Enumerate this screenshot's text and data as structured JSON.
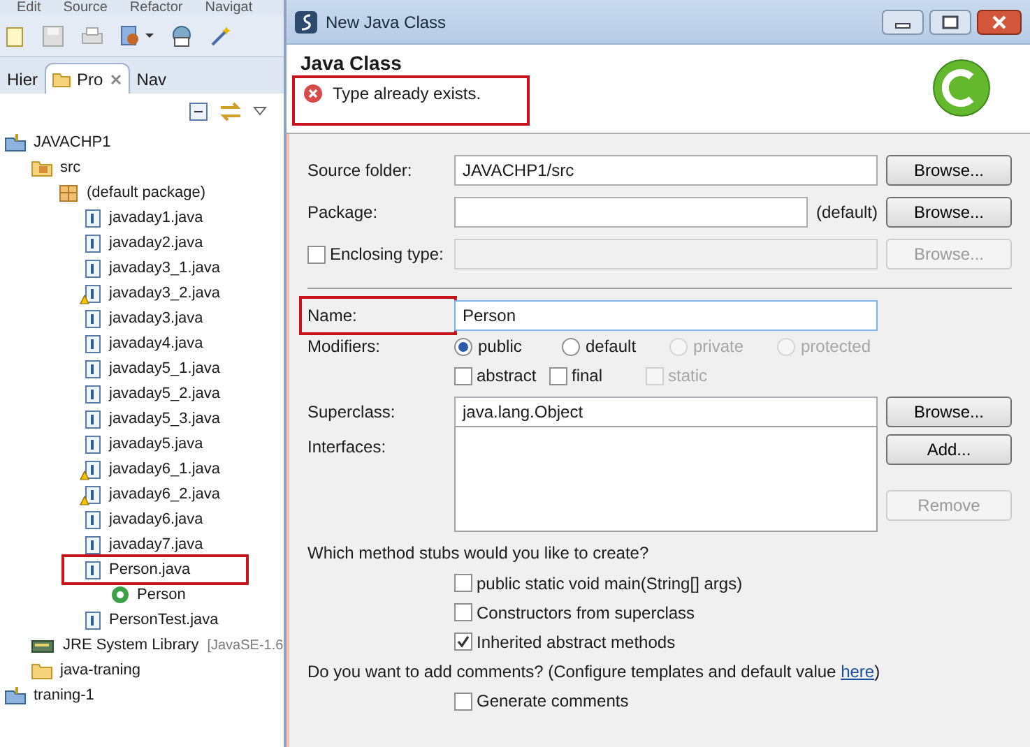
{
  "menu": [
    "Edit",
    "Source",
    "Refactor",
    "Navigat"
  ],
  "view_tabs": [
    {
      "label": "Hier",
      "selected": false,
      "closable": false
    },
    {
      "label": "Pro",
      "selected": true,
      "closable": true
    },
    {
      "label": "Nav",
      "selected": false,
      "closable": false
    }
  ],
  "tree": [
    {
      "label": "JAVACHP1",
      "kind": "project",
      "children": [
        {
          "label": "src",
          "kind": "source-folder",
          "children": [
            {
              "label": "(default package)",
              "kind": "package",
              "children": [
                {
                  "label": "javaday1.java",
                  "kind": "file",
                  "warning": false,
                  "highlighted": false
                },
                {
                  "label": "javaday2.java",
                  "kind": "file",
                  "warning": false,
                  "highlighted": false
                },
                {
                  "label": "javaday3_1.java",
                  "kind": "file",
                  "warning": false,
                  "highlighted": false
                },
                {
                  "label": "javaday3_2.java",
                  "kind": "file",
                  "warning": true,
                  "highlighted": false
                },
                {
                  "label": "javaday3.java",
                  "kind": "file",
                  "warning": false,
                  "highlighted": false
                },
                {
                  "label": "javaday4.java",
                  "kind": "file",
                  "warning": false,
                  "highlighted": false
                },
                {
                  "label": "javaday5_1.java",
                  "kind": "file",
                  "warning": false,
                  "highlighted": false
                },
                {
                  "label": "javaday5_2.java",
                  "kind": "file",
                  "warning": false,
                  "highlighted": false
                },
                {
                  "label": "javaday5_3.java",
                  "kind": "file",
                  "warning": false,
                  "highlighted": false
                },
                {
                  "label": "javaday5.java",
                  "kind": "file",
                  "warning": false,
                  "highlighted": false
                },
                {
                  "label": "javaday6_1.java",
                  "kind": "file",
                  "warning": true,
                  "highlighted": false
                },
                {
                  "label": "javaday6_2.java",
                  "kind": "file",
                  "warning": true,
                  "highlighted": false
                },
                {
                  "label": "javaday6.java",
                  "kind": "file",
                  "warning": false,
                  "highlighted": false
                },
                {
                  "label": "javaday7.java",
                  "kind": "file",
                  "warning": false,
                  "highlighted": false
                },
                {
                  "label": "Person.java",
                  "kind": "file",
                  "warning": false,
                  "highlighted": true,
                  "children": [
                    {
                      "label": "Person",
                      "kind": "class"
                    }
                  ]
                },
                {
                  "label": "PersonTest.java",
                  "kind": "file",
                  "warning": false,
                  "highlighted": false
                }
              ]
            }
          ]
        },
        {
          "label": "JRE System Library",
          "decoration": "[JavaSE-1.6",
          "kind": "library"
        },
        {
          "label": "java-traning",
          "kind": "folder"
        }
      ]
    },
    {
      "label": "traning-1",
      "kind": "project"
    }
  ],
  "dialog": {
    "title": "New Java Class",
    "heading": "Java Class",
    "error": {
      "message": "Type already exists.",
      "highlighted": true
    },
    "source_folder": {
      "label": "Source folder:",
      "value": "JAVACHP1/src",
      "button": "Browse..."
    },
    "package": {
      "label": "Package:",
      "hint": "(default)",
      "button": "Browse..."
    },
    "enclosing_type": {
      "label": "Enclosing type:",
      "checked": false,
      "button": "Browse...",
      "disabled": true
    },
    "name": {
      "label": "Name:",
      "value": "Person",
      "highlighted": true
    },
    "modifiers": {
      "label": "Modifiers:",
      "radios": [
        {
          "label": "public",
          "selected": true,
          "disabled": false
        },
        {
          "label": "default",
          "selected": false,
          "disabled": false
        },
        {
          "label": "private",
          "selected": false,
          "disabled": true
        },
        {
          "label": "protected",
          "selected": false,
          "disabled": true
        }
      ],
      "checks": [
        {
          "label": "abstract",
          "checked": false,
          "disabled": false
        },
        {
          "label": "final",
          "checked": false,
          "disabled": false
        },
        {
          "label": "static",
          "checked": false,
          "disabled": true
        }
      ]
    },
    "superclass": {
      "label": "Superclass:",
      "value": "java.lang.Object",
      "button": "Browse..."
    },
    "interfaces": {
      "label": "Interfaces:",
      "buttons": [
        {
          "label": "Add...",
          "disabled": false
        },
        {
          "label": "Remove",
          "disabled": true
        }
      ]
    },
    "stubs": {
      "question": "Which method stubs would you like to create?",
      "options": [
        {
          "label": "public static void main(String[] args)",
          "checked": false
        },
        {
          "label": "Constructors from superclass",
          "checked": false
        },
        {
          "label": "Inherited abstract methods",
          "checked": true
        }
      ]
    },
    "comments": {
      "before": "Do you want to add comments? (Configure templates and default value ",
      "link": "here",
      "after": ")",
      "option": {
        "label": "Generate comments",
        "checked": false
      }
    }
  }
}
